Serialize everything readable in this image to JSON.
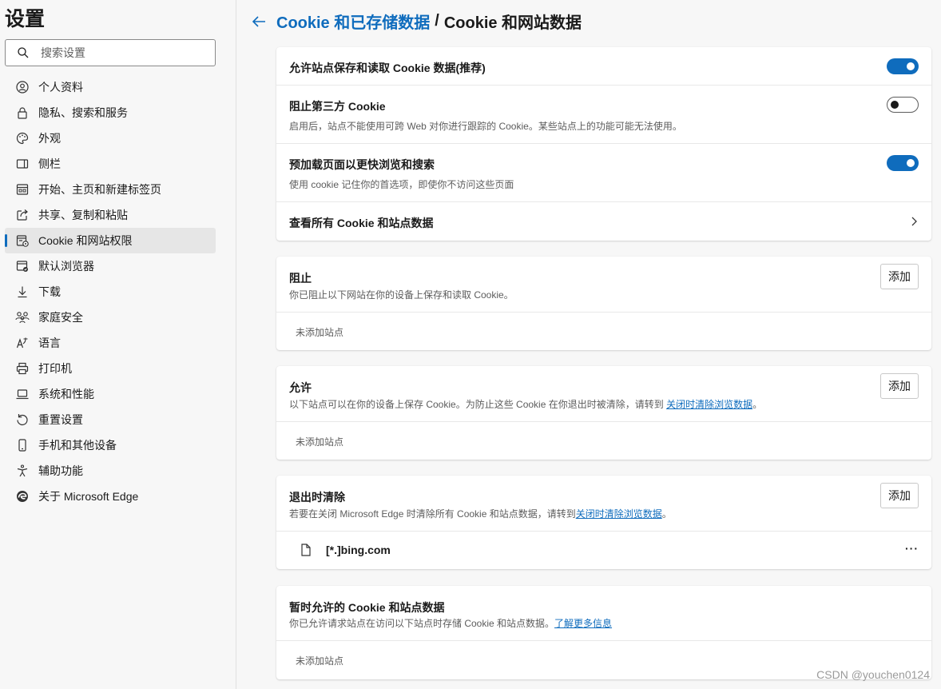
{
  "sidebar": {
    "title": "设置",
    "search_placeholder": "搜索设置",
    "items": [
      {
        "label": "个人资料",
        "icon": "profile-icon"
      },
      {
        "label": "隐私、搜索和服务",
        "icon": "lock-icon"
      },
      {
        "label": "外观",
        "icon": "palette-icon"
      },
      {
        "label": "侧栏",
        "icon": "sidebar-icon"
      },
      {
        "label": "开始、主页和新建标签页",
        "icon": "home-tabs-icon"
      },
      {
        "label": "共享、复制和粘贴",
        "icon": "share-icon"
      },
      {
        "label": "Cookie 和网站权限",
        "icon": "cookie-site-icon",
        "active": true
      },
      {
        "label": "默认浏览器",
        "icon": "browser-icon"
      },
      {
        "label": "下载",
        "icon": "download-icon"
      },
      {
        "label": "家庭安全",
        "icon": "family-icon"
      },
      {
        "label": "语言",
        "icon": "language-icon"
      },
      {
        "label": "打印机",
        "icon": "printer-icon"
      },
      {
        "label": "系统和性能",
        "icon": "laptop-icon"
      },
      {
        "label": "重置设置",
        "icon": "reset-icon"
      },
      {
        "label": "手机和其他设备",
        "icon": "phone-icon"
      },
      {
        "label": "辅助功能",
        "icon": "accessibility-icon"
      },
      {
        "label": "关于 Microsoft Edge",
        "icon": "edge-icon"
      }
    ]
  },
  "header": {
    "parent_link": "Cookie 和已存储数据",
    "separator": "/",
    "current": "Cookie 和网站数据"
  },
  "general": {
    "allow_title": "允许站点保存和读取 Cookie 数据(推荐)",
    "allow_on": true,
    "block_third_title": "阻止第三方 Cookie",
    "block_third_desc": "启用后，站点不能使用可跨 Web 对你进行跟踪的 Cookie。某些站点上的功能可能无法使用。",
    "block_third_on": false,
    "preload_title": "预加载页面以更快浏览和搜索",
    "preload_desc": "使用 cookie 记住你的首选项，即使你不访问这些页面",
    "preload_on": true,
    "see_all_title": "查看所有 Cookie 和站点数据"
  },
  "block": {
    "title": "阻止",
    "desc": "你已阻止以下网站在你的设备上保存和读取 Cookie。",
    "add_label": "添加",
    "empty": "未添加站点"
  },
  "allow": {
    "title": "允许",
    "desc": "以下站点可以在你的设备上保存 Cookie。为防止这些 Cookie 在你退出时被清除，请转到",
    "link": "关闭时清除浏览数据",
    "desc_end": "。",
    "add_label": "添加",
    "empty": "未添加站点"
  },
  "clear_on_exit": {
    "title": "退出时清除",
    "desc": "若要在关闭 Microsoft Edge 时清除所有 Cookie 和站点数据，请转到",
    "link": "关闭时清除浏览数据",
    "desc_end": "。",
    "add_label": "添加",
    "site": "[*.]bing.com",
    "more": "···"
  },
  "temp_allowed": {
    "title": "暂时允许的 Cookie 和站点数据",
    "desc": "你已允许请求站点在访问以下站点时存储 Cookie 和站点数据。",
    "link": "了解更多信息",
    "empty": "未添加站点"
  },
  "watermark": "CSDN @youchen0124",
  "colors": {
    "accent": "#0f6cbd",
    "background": "#f7f7f7",
    "card": "#ffffff"
  }
}
